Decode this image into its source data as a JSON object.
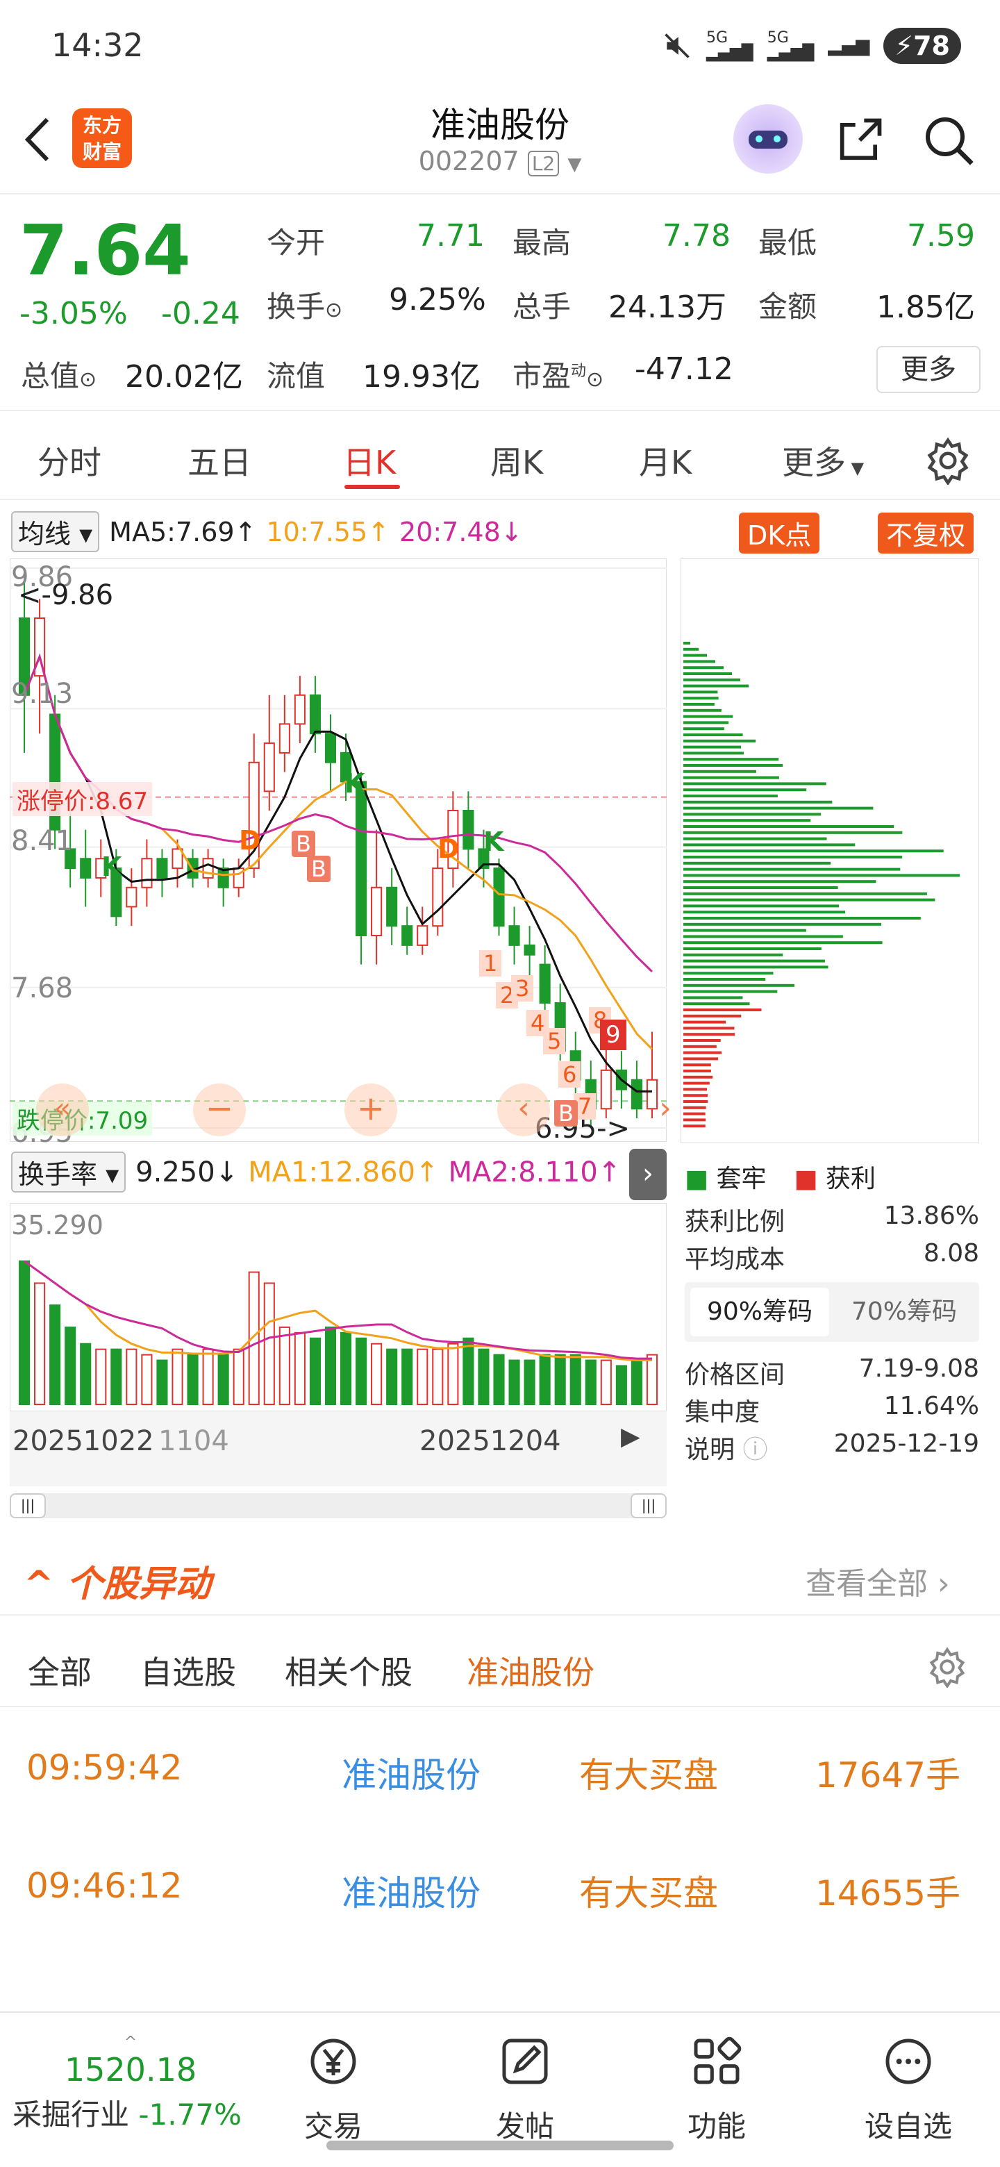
{
  "status_bar": {
    "time": "14:32",
    "battery": "78",
    "network": "5G"
  },
  "header": {
    "title": "准油股份",
    "code": "002207",
    "level": "L2",
    "logo_line1": "东方",
    "logo_line2": "财富"
  },
  "quote": {
    "price": "7.64",
    "change_pct": "-3.05%",
    "change": "-0.24",
    "open_label": "今开",
    "open": "7.71",
    "high_label": "最高",
    "high": "7.78",
    "low_label": "最低",
    "low": "7.59",
    "turnover_label": "换手",
    "turnover": "9.25%",
    "volume_label": "总手",
    "volume": "24.13万",
    "amount_label": "金额",
    "amount": "1.85亿",
    "mcap_label": "总值",
    "mcap": "20.02亿",
    "float_label": "流值",
    "float": "19.93亿",
    "pe_label": "市盈",
    "pe_sup": "动",
    "pe": "-47.12",
    "more": "更多"
  },
  "tabs": [
    "分时",
    "五日",
    "日K",
    "周K",
    "月K",
    "更多"
  ],
  "active_tab": "日K",
  "chart_legend": {
    "ma_selector": "均线",
    "ma5": "MA5:7.69",
    "ma10": "10:7.55",
    "ma20": "20:7.48",
    "dk_button": "DK点",
    "adj_button": "不复权"
  },
  "chart_labels": {
    "y_ticks": [
      "9.86",
      "9.13",
      "8.41",
      "7.68",
      "6.95"
    ],
    "high_marker": "<-9.86",
    "low_marker": "6.95->",
    "limit_up": "涨停价:8.67",
    "limit_down": "跌停价:7.09",
    "signals": [
      "K",
      "D",
      "B",
      "B",
      "K",
      "D",
      "K",
      "1",
      "2",
      "3",
      "4",
      "5",
      "6",
      "7",
      "8",
      "9",
      "B"
    ]
  },
  "turnover_legend": {
    "selector": "换手率",
    "value": "9.250",
    "ma1": "MA1:12.860",
    "ma2": "MA2:8.110",
    "y_top": "35.290",
    "x_labels": [
      "20251022",
      "1104",
      "20251204"
    ]
  },
  "chip_panel": {
    "legend_trapped": "套牢",
    "legend_profit": "获利",
    "profit_ratio_label": "获利比例",
    "profit_ratio": "13.86%",
    "avg_cost_label": "平均成本",
    "avg_cost": "8.08",
    "tab_90": "90%筹码",
    "tab_70": "70%筹码",
    "range_label": "价格区间",
    "range": "7.19-9.08",
    "concentration_label": "集中度",
    "concentration": "11.64%",
    "note_label": "说明",
    "date": "2025-12-19"
  },
  "chart_data": {
    "type": "candlestick",
    "y_ticks": [
      9.86,
      9.13,
      8.41,
      7.68,
      6.95
    ],
    "ylim": [
      6.95,
      9.86
    ],
    "limit_up": 8.67,
    "limit_down": 7.09,
    "candles": [
      [
        9.6,
        9.2,
        9.86,
        8.9
      ],
      [
        9.3,
        9.6,
        9.7,
        9.0
      ],
      [
        9.1,
        8.5,
        9.2,
        8.4
      ],
      [
        8.4,
        8.3,
        8.6,
        8.2
      ],
      [
        8.35,
        8.25,
        8.5,
        8.1
      ],
      [
        8.25,
        8.35,
        8.45,
        8.15
      ],
      [
        8.3,
        8.05,
        8.4,
        8.0
      ],
      [
        8.1,
        8.2,
        8.3,
        8.0
      ],
      [
        8.2,
        8.35,
        8.45,
        8.1
      ],
      [
        8.35,
        8.25,
        8.4,
        8.15
      ],
      [
        8.3,
        8.4,
        8.45,
        8.2
      ],
      [
        8.35,
        8.25,
        8.4,
        8.2
      ],
      [
        8.25,
        8.35,
        8.4,
        8.2
      ],
      [
        8.3,
        8.2,
        8.35,
        8.1
      ],
      [
        8.2,
        8.3,
        8.35,
        8.15
      ],
      [
        8.3,
        8.85,
        9.0,
        8.25
      ],
      [
        8.7,
        8.95,
        9.2,
        8.6
      ],
      [
        8.9,
        9.05,
        9.2,
        8.8
      ],
      [
        9.05,
        9.2,
        9.3,
        8.95
      ],
      [
        9.2,
        9.0,
        9.3,
        8.9
      ],
      [
        9.0,
        8.85,
        9.1,
        8.7
      ],
      [
        8.9,
        8.75,
        9.0,
        8.65
      ],
      [
        8.75,
        7.95,
        8.8,
        7.8
      ],
      [
        7.95,
        8.2,
        8.5,
        7.8
      ],
      [
        8.2,
        8.0,
        8.3,
        7.9
      ],
      [
        8.0,
        7.9,
        8.1,
        7.85
      ],
      [
        7.9,
        8.0,
        8.1,
        7.85
      ],
      [
        8.0,
        8.3,
        8.4,
        7.95
      ],
      [
        8.3,
        8.6,
        8.7,
        8.2
      ],
      [
        8.6,
        8.4,
        8.7,
        8.3
      ],
      [
        8.4,
        8.3,
        8.5,
        8.2
      ],
      [
        8.3,
        8.0,
        8.35,
        7.95
      ],
      [
        8.0,
        7.9,
        8.1,
        7.8
      ],
      [
        7.9,
        7.85,
        8.0,
        7.7
      ],
      [
        7.8,
        7.6,
        7.9,
        7.5
      ],
      [
        7.6,
        7.35,
        7.7,
        7.3
      ],
      [
        7.35,
        7.2,
        7.45,
        7.1
      ],
      [
        7.2,
        7.05,
        7.3,
        6.95
      ],
      [
        7.05,
        7.25,
        7.4,
        7.0
      ],
      [
        7.25,
        7.15,
        7.35,
        7.05
      ],
      [
        7.2,
        7.05,
        7.3,
        7.0
      ],
      [
        7.05,
        7.2,
        7.45,
        7.0
      ]
    ],
    "turnover": [
      26,
      22,
      18,
      14,
      11,
      10,
      10,
      10,
      9,
      8,
      10,
      9,
      10,
      9,
      10,
      24,
      22,
      14,
      13,
      12,
      14,
      13,
      12,
      11,
      10,
      10,
      10,
      10,
      11,
      12,
      10,
      9,
      8,
      8,
      9,
      9,
      9,
      8,
      8,
      7,
      8,
      9
    ]
  },
  "alerts": {
    "title": "个股异动",
    "view_all": "查看全部",
    "filters": [
      "全部",
      "自选股",
      "相关个股",
      "准油股份"
    ],
    "active_filter": "准油股份",
    "rows": [
      {
        "time": "09:59:42",
        "stock": "准油股份",
        "type": "有大买盘",
        "qty": "17647手"
      },
      {
        "time": "09:46:12",
        "stock": "准油股份",
        "type": "有大买盘",
        "qty": "14655手"
      }
    ]
  },
  "bottom_nav": {
    "index_value": "1520.18",
    "index_name": "采掘行业",
    "index_change": "-1.77%",
    "items": [
      "交易",
      "发帖",
      "功能",
      "设自选"
    ]
  }
}
